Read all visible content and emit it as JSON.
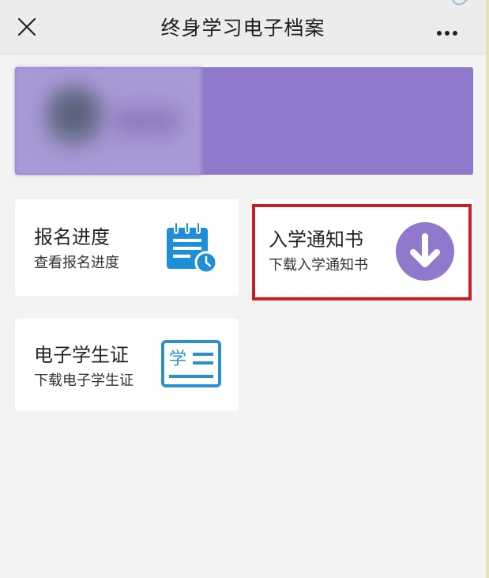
{
  "header": {
    "title": "终身学习电子档案",
    "close_icon": "close-icon",
    "more_icon": "more-icon"
  },
  "profile": {
    "avatar": "blurred-avatar",
    "name": "blurred-name"
  },
  "cards": [
    {
      "title": "报名进度",
      "subtitle": "查看报名进度",
      "icon": "calendar-clock-icon",
      "icon_color": "#1e8ed6"
    },
    {
      "title": "入学通知书",
      "subtitle": "下载入学通知书",
      "icon": "download-icon",
      "icon_color": "#9079cc",
      "highlighted": true
    },
    {
      "title": "电子学生证",
      "subtitle": "下载电子学生证",
      "icon": "student-card-icon",
      "icon_color": "#2a90c9"
    }
  ],
  "colors": {
    "background": "#f3f3f3",
    "header_background": "#ececec",
    "profile_banner": "#9079cc",
    "highlight": "#c81f24"
  }
}
